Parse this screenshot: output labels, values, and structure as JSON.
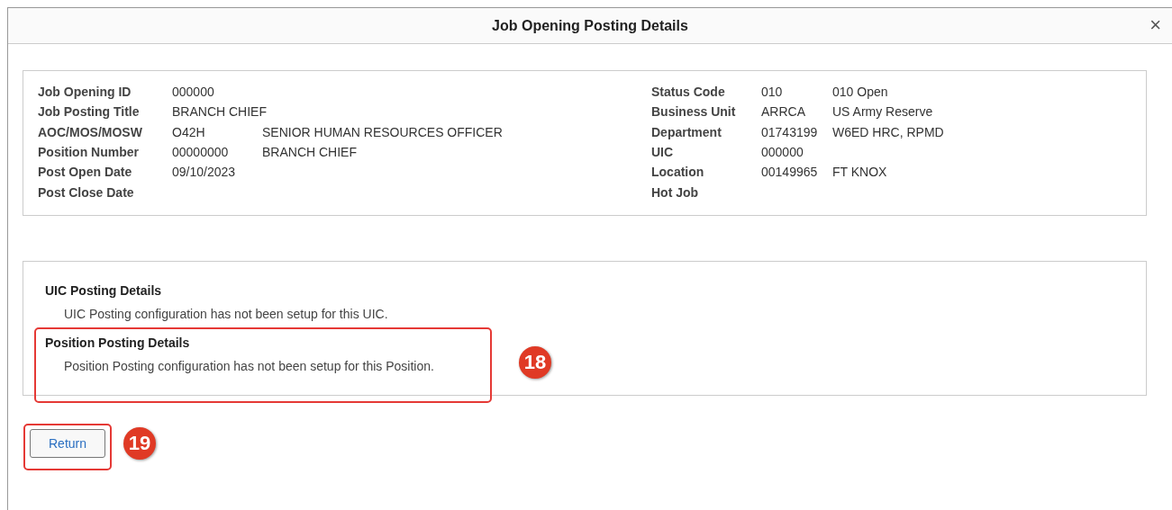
{
  "dialog": {
    "title": "Job Opening Posting Details",
    "close": "×"
  },
  "fields_left": [
    {
      "label": "Job Opening ID",
      "values": [
        "000000"
      ]
    },
    {
      "label": "Job Posting Title",
      "values": [
        "BRANCH CHIEF"
      ]
    },
    {
      "label": "AOC/MOS/MOSW",
      "values": [
        "O42H",
        "SENIOR HUMAN RESOURCES OFFICER"
      ]
    },
    {
      "label": "Position Number",
      "values": [
        "00000000",
        "BRANCH CHIEF"
      ]
    },
    {
      "label": "Post Open Date",
      "values": [
        "09/10/2023"
      ]
    },
    {
      "label": "Post Close Date"
    }
  ],
  "fields_right": [
    {
      "label": "Status Code",
      "values": [
        "010",
        "010 Open"
      ]
    },
    {
      "label": "Business Unit",
      "values": [
        "ARRCA",
        "US Army Reserve"
      ]
    },
    {
      "label": "Department",
      "values": [
        "01743199",
        "W6ED HRC, RPMD"
      ]
    },
    {
      "label": "UIC",
      "values": [
        "000000"
      ]
    },
    {
      "label": "Location",
      "values": [
        "00149965",
        "FT KNOX"
      ]
    },
    {
      "label": "Hot Job"
    }
  ],
  "posting_sections": [
    {
      "heading": "UIC Posting Details",
      "message": "UIC Posting configuration has not been setup for this UIC."
    },
    {
      "heading": "Position Posting Details",
      "message": "Position Posting configuration has not been setup for this Position.",
      "callout": "18"
    }
  ],
  "return_button": {
    "label": "Return",
    "callout": "19"
  }
}
